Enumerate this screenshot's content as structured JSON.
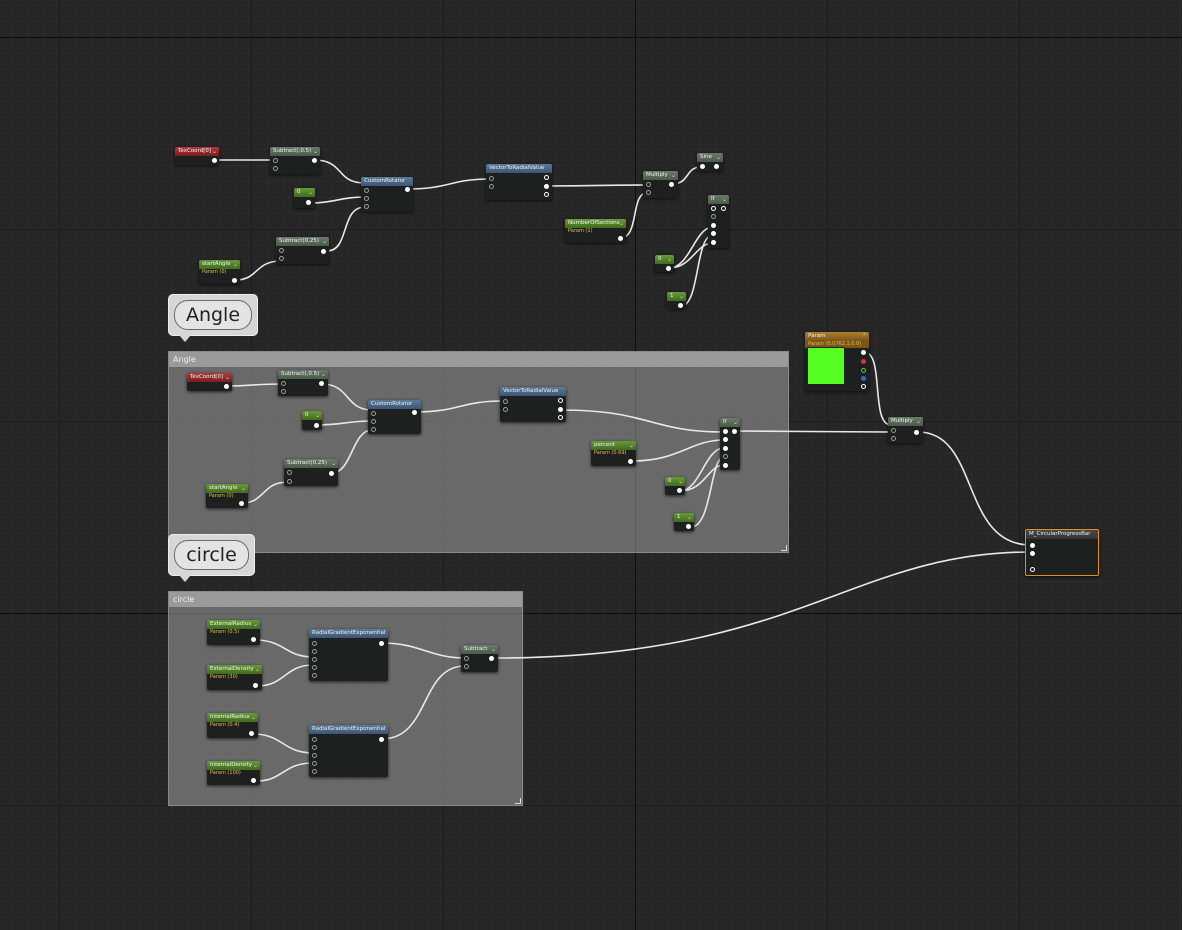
{
  "comments": {
    "angle_title": "Angle",
    "angle_bubble": "Angle",
    "circle_title": "circle",
    "circle_bubble": "circle"
  },
  "top_cluster": {
    "texcoord": "TexCoord[0]",
    "subtract_05": "Subtract(,0.5)",
    "subtract_025": "Subtract(0,25)",
    "custom_rotator": "CustomRotator",
    "vector_to_radial": "VectorToRadialValue",
    "multiply": "Multiply",
    "sine": "Sine",
    "number_of_sections": "NumberOfSections",
    "number_of_sections_sub": "Param (1)",
    "start_angle": "startAngle",
    "start_angle_sub": "Param (0)",
    "const0": "0",
    "const0b": "0",
    "const1": "1",
    "if_node": "If"
  },
  "angle_group": {
    "texcoord": "TexCoord[0]",
    "subtract_05": "Subtract(,0.5)",
    "subtract_025": "Subtract(0,25)",
    "custom_rotator": "CustomRotator",
    "vector_to_radial": "VectorToRadialValue",
    "percent": "percent",
    "percent_sub": "Param (0.69)",
    "start_angle": "startAngle",
    "start_angle_sub": "Param (0)",
    "const0": "0",
    "const0b": "0",
    "const1": "1",
    "if_node": "If"
  },
  "param_node": {
    "title": "Param",
    "sub": "Param (0.0762,1,0.0)",
    "color": "#55ff22"
  },
  "right_cluster": {
    "multiply": "Multiply",
    "output": "M_CircularProgressBar"
  },
  "circle_group": {
    "external_radius": "ExternalRadius",
    "external_radius_sub": "Param (0.5)",
    "external_density": "ExternalDensity",
    "external_density_sub": "Param (30)",
    "internal_radius": "InternalRadius",
    "internal_radius_sub": "Param (0.4)",
    "internal_density": "InternalDensity",
    "internal_density_sub": "Param (100)",
    "radial_gradient_1": "RadialGradientExponential",
    "radial_gradient_2": "RadialGradientExponential",
    "subtract": "Subtract"
  },
  "colors": {
    "canvas": "#262626",
    "output_border": "#e09020",
    "param_swatch": "#55ff22"
  }
}
